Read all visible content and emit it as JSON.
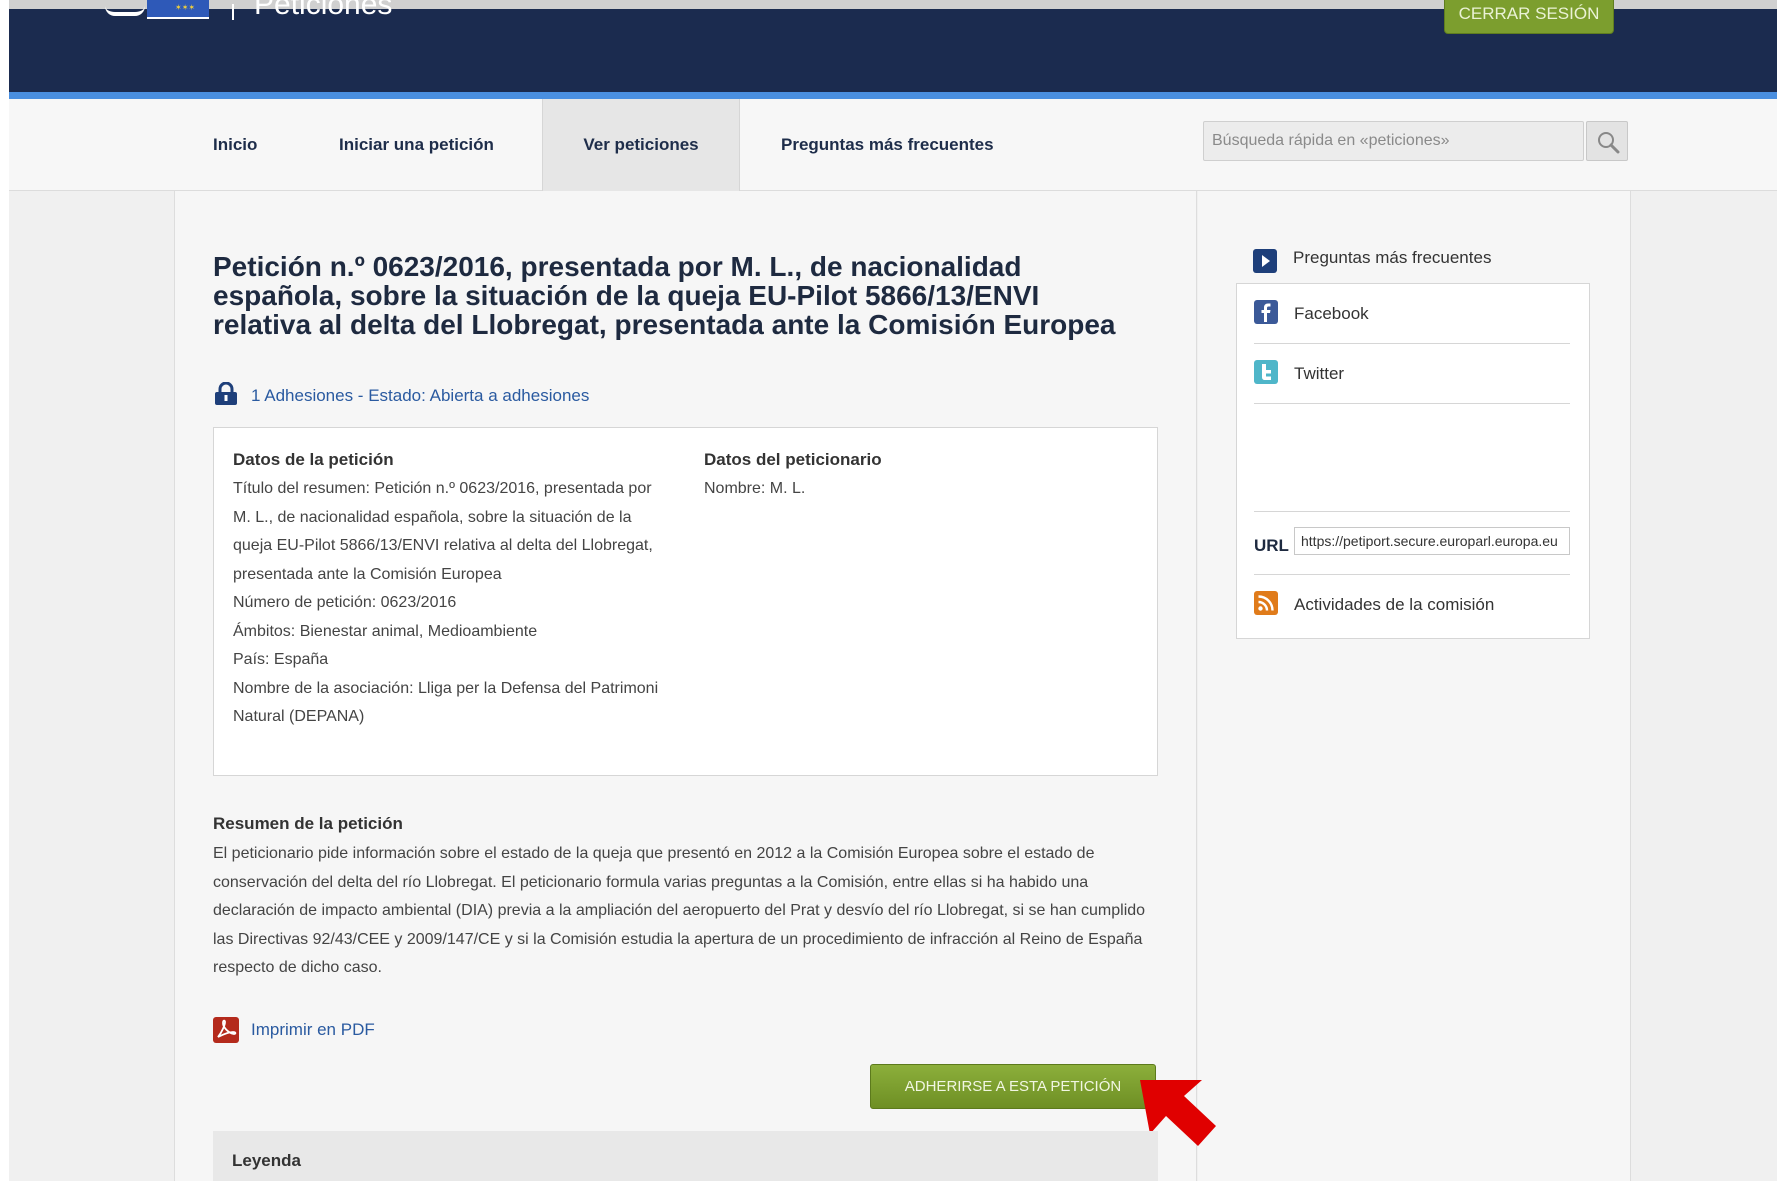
{
  "header": {
    "site_title": "Peticiones",
    "logout_label": "CERRAR SESIÓN"
  },
  "nav": {
    "items": [
      {
        "label": "Inicio"
      },
      {
        "label": "Iniciar una petición"
      },
      {
        "label": "Ver peticiones",
        "active": true
      },
      {
        "label": "Preguntas más frecuentes"
      }
    ],
    "search_placeholder": "Búsqueda rápida en «peticiones»"
  },
  "petition": {
    "title": "Petición n.º 0623/2016, presentada por M. L., de nacionalidad española, sobre la situación de la queja EU-Pilot 5866/13/ENVI relativa al delta del Llobregat, presentada ante la Comisión Europea",
    "status": "1 Adhesiones - Estado: Abierta a adhesiones",
    "data_heading": "Datos de la petición",
    "summary_title": "Título del resumen: Petición n.º 0623/2016, presentada por M. L., de nacionalidad española, sobre la situación de la queja EU-Pilot 5866/13/ENVI relativa al delta del Llobregat, presentada ante la Comisión Europea",
    "number": "Número de petición: 0623/2016",
    "scopes": "Ámbitos: Bienestar animal,  Medioambiente",
    "country": "País: España",
    "association": "Nombre de la asociación: Lliga per la Defensa del Patrimoni Natural (DEPANA)",
    "petitioner_heading": "Datos del peticionario",
    "petitioner_name": "Nombre: M. L.",
    "summary_heading": "Resumen de la petición",
    "summary_text": "El peticionario pide información sobre el estado de la queja que presentó en 2012 a la Comisión Europea sobre el estado de conservación del delta del río Llobregat. El peticionario formula varias preguntas a la Comisión, entre ellas si ha habido una declaración de impacto ambiental (DIA) previa a la ampliación del aeropuerto del Prat y desvío del río Llobregat, si se han cumplido las Directivas 92/43/CEE y 2009/147/CE y si la Comisión estudia la apertura de un procedimiento de infracción al Reino de España respecto de dicho caso.",
    "pdf_label": "Imprimir en PDF",
    "adhere_label": "ADHERIRSE A ESTA PETICIÓN",
    "legend_heading": "Leyenda"
  },
  "sidebar": {
    "faq_label": "Preguntas más frecuentes",
    "facebook_label": "Facebook",
    "twitter_label": "Twitter",
    "url_label": "URL",
    "url_value": "https://petiport.secure.europarl.europa.eu",
    "rss_label": "Actividades de la comisión"
  },
  "colors": {
    "header_bg": "#1b2b4f",
    "accent_blue": "#4a8fe0",
    "button_green": "#7c9e2e",
    "link_blue": "#2a5aa0",
    "annotation_red": "#e00000"
  }
}
